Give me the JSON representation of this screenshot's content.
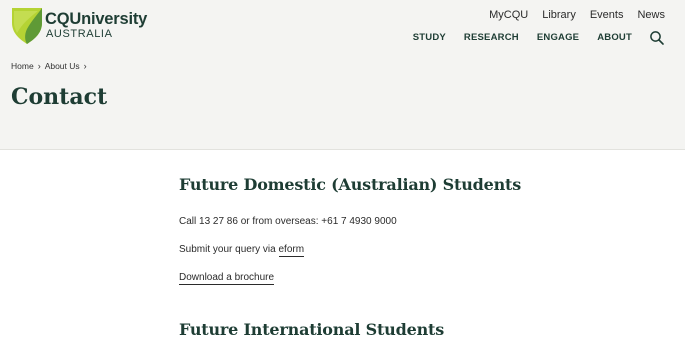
{
  "brand": {
    "name": "CQUniversity",
    "sub": "AUSTRALIA",
    "colors": {
      "shield_light": "#b5d334",
      "shield_dark": "#5f9a36",
      "text": "#1e3d34"
    }
  },
  "utility_nav": [
    "MyCQU",
    "Library",
    "Events",
    "News"
  ],
  "main_nav": [
    "STUDY",
    "RESEARCH",
    "ENGAGE",
    "ABOUT"
  ],
  "search_icon": "search-icon",
  "breadcrumb": [
    "Home",
    "About Us"
  ],
  "page_title": "Contact",
  "domestic": {
    "heading": "Future Domestic (Australian) Students",
    "call": "Call 13 27 86 or from overseas: +61 7 4930 9000",
    "submit_prefix": "Submit your query via ",
    "eform": "eform",
    "brochure": "Download a brochure"
  },
  "international": {
    "heading": "Future International Students"
  }
}
